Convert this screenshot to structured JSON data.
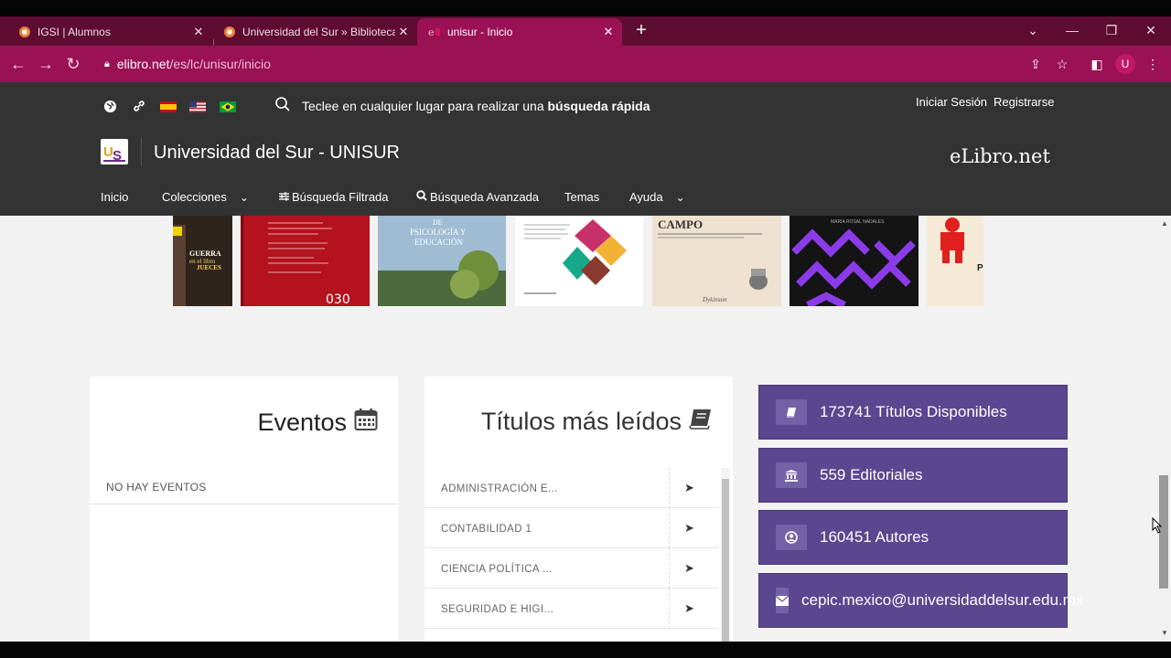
{
  "browser": {
    "tabs": [
      {
        "title": "IGSI | Alumnos",
        "close": "✕",
        "active": false
      },
      {
        "title": "Universidad del Sur » Biblioteca Vi",
        "close": "✕",
        "active": false
      },
      {
        "title": "unisur - Inicio",
        "close": "✕",
        "active": true
      }
    ],
    "new_tab": "+",
    "url_host": "elibro.net",
    "url_path": "/es/lc/unisur/inicio",
    "profile_initial": "U"
  },
  "header": {
    "quick_search_prefix": "Teclee en cualquier lugar para realizar una ",
    "quick_search_bold": "búsqueda rápida",
    "login": "Iniciar Sesión",
    "register": "Registrarse",
    "logo_text": "US",
    "site_title": "Universidad del Sur - UNISUR",
    "brand": "eLibro.net",
    "nav": {
      "home": "Inicio",
      "collections": "Colecciones",
      "filtered": "Búsqueda Filtrada",
      "advanced": "Búsqueda Avanzada",
      "topics": "Temas",
      "help": "Ayuda"
    }
  },
  "books": [
    {
      "cover_text": "GUERRA en el libro de los JUECES",
      "color": "#3a2d22"
    },
    {
      "cover_text": "",
      "color": "#b3121e"
    },
    {
      "cover_text": "DE PSICOLOGÍA Y EDUCACIÓN",
      "color": "#a9c2d3"
    },
    {
      "cover_text": "",
      "color": "#ffffff"
    },
    {
      "cover_text": "CAMPO",
      "color": "#efe1cf"
    },
    {
      "cover_text": "",
      "color": "#1a1a1a"
    },
    {
      "cover_text": "",
      "color": "#f4ead6"
    }
  ],
  "eventos": {
    "title": "Eventos",
    "empty": "NO HAY EVENTOS"
  },
  "titulos": {
    "title": "Títulos más leídos",
    "rows": [
      "ADMINISTRACIÓN E...",
      "CONTABILIDAD 1",
      "CIENCIA POLÍTICA ...",
      "SEGURIDAD E HIGI..."
    ]
  },
  "stats": [
    {
      "text": "173741 Títulos Disponibles",
      "icon": "book-icon"
    },
    {
      "text": "559 Editoriales",
      "icon": "institution-icon"
    },
    {
      "text": "160451 Autores",
      "icon": "user-circle-icon"
    },
    {
      "text": "cepic.mexico@universidaddelsur.edu.mx",
      "icon": "envelope-icon"
    }
  ]
}
